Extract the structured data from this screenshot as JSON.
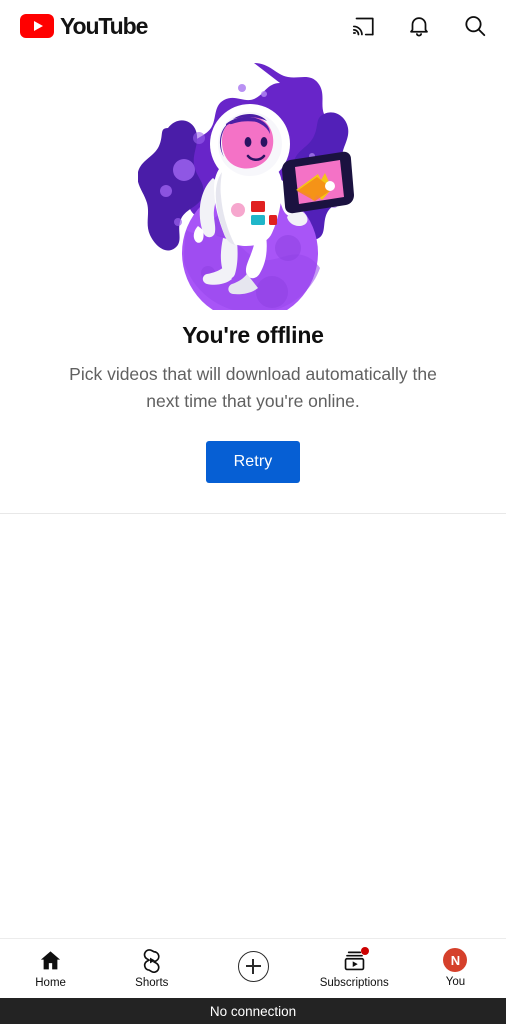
{
  "header": {
    "logo_text": "YouTube",
    "logo_color": "#FF0000",
    "icons": [
      {
        "name": "cast-icon",
        "label": "Cast"
      },
      {
        "name": "notifications-icon",
        "label": "Notifications"
      },
      {
        "name": "search-icon",
        "label": "Search"
      }
    ]
  },
  "offline": {
    "illustration_name": "astronaut-on-planet-illustration",
    "title": "You're offline",
    "subtitle": "Pick videos that will download automatically the next time that you're online.",
    "retry_label": "Retry",
    "retry_color": "#065FD4"
  },
  "bottom_nav": {
    "items": [
      {
        "label": "Home",
        "icon": "home-icon",
        "badge": false
      },
      {
        "label": "Shorts",
        "icon": "shorts-icon",
        "badge": false
      },
      {
        "label": "",
        "icon": "create-plus-icon",
        "badge": false
      },
      {
        "label": "Subscriptions",
        "icon": "subscriptions-icon",
        "badge": true
      },
      {
        "label": "You",
        "icon": "avatar-icon",
        "badge": false,
        "avatar_initial": "N",
        "avatar_color": "#D5402B"
      }
    ]
  },
  "status": {
    "message": "No connection",
    "background": "#232323"
  }
}
